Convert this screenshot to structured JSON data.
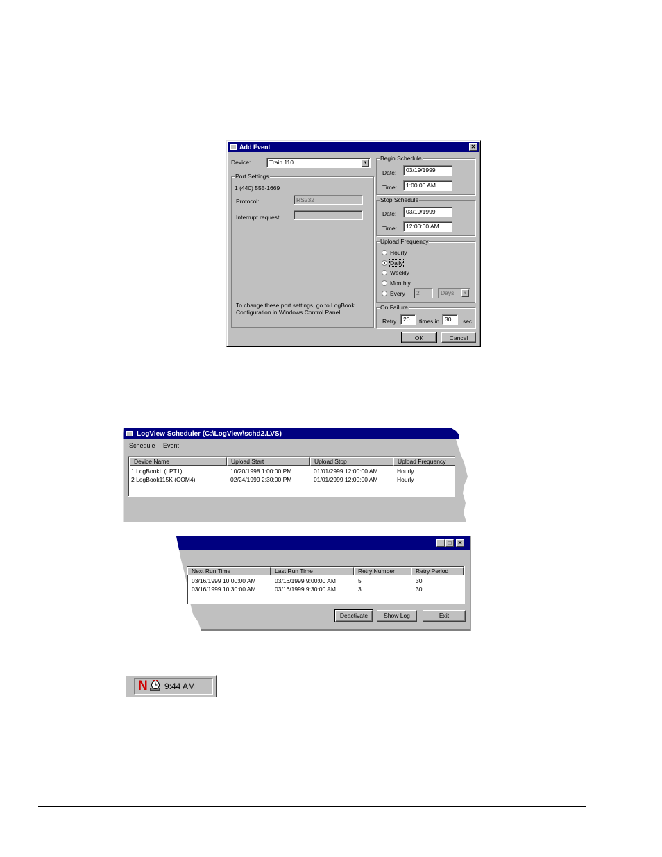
{
  "add_event": {
    "title": "Add Event",
    "device_label": "Device:",
    "device_value": "Train 110",
    "port_settings": {
      "title": "Port Settings",
      "phone": "1 (440) 555-1669",
      "protocol_label": "Protocol:",
      "protocol_value": "RS232",
      "irq_label": "Interrupt request:",
      "irq_value": "",
      "note": "To change these port settings, go to LogBook Configuration in Windows Control Panel."
    },
    "begin_schedule": {
      "title": "Begin Schedule",
      "date_label": "Date:",
      "date_value": "03/19/1999",
      "time_label": "Time:",
      "time_value": "1:00:00 AM"
    },
    "stop_schedule": {
      "title": "Stop Schedule",
      "date_label": "Date:",
      "date_value": "03/19/1999",
      "time_label": "Time:",
      "time_value": "12:00:00 AM"
    },
    "upload_frequency": {
      "title": "Upload Frequency",
      "options": [
        "Hourly",
        "Daily",
        "Weekly",
        "Monthly",
        "Every"
      ],
      "selected": "Daily",
      "every_value": "2",
      "every_unit": "Days"
    },
    "on_failure": {
      "title": "On Failure",
      "retry_label": "Retry",
      "retry_value": "20",
      "times_in_label": "times in",
      "interval_value": "30",
      "sec_label": "sec"
    },
    "ok_label": "OK",
    "cancel_label": "Cancel"
  },
  "scheduler": {
    "title": "LogView Scheduler (C:\\LogView\\schd2.LVS)",
    "menu": [
      "Schedule",
      "Event"
    ],
    "columns_left": [
      "Device Name",
      "Upload Start",
      "Upload Stop",
      "Upload Frequency"
    ],
    "rows_left": [
      [
        "1  LogBookL (LPT1)",
        "10/20/1998 1:00:00 PM",
        "01/01/2999 12:00:00 AM",
        "Hourly"
      ],
      [
        "2  LogBook115K (COM4)",
        "02/24/1999 2:30:00 PM",
        "01/01/2999 12:00:00 AM",
        "Hourly"
      ]
    ],
    "columns_right": [
      "Next Run Time",
      "Last Run Time",
      "Retry Number",
      "Retry Period"
    ],
    "rows_right": [
      [
        "03/16/1999 10:00:00 AM",
        "03/16/1999 9:00:00 AM",
        "5",
        "30"
      ],
      [
        "03/16/1999 10:30:00 AM",
        "03/16/1999 9:30:00 AM",
        "3",
        "30"
      ]
    ],
    "deactivate_label": "Deactivate",
    "show_log_label": "Show Log",
    "exit_label": "Exit"
  },
  "tray": {
    "time": "9:44 AM",
    "n_glyph": "N"
  }
}
